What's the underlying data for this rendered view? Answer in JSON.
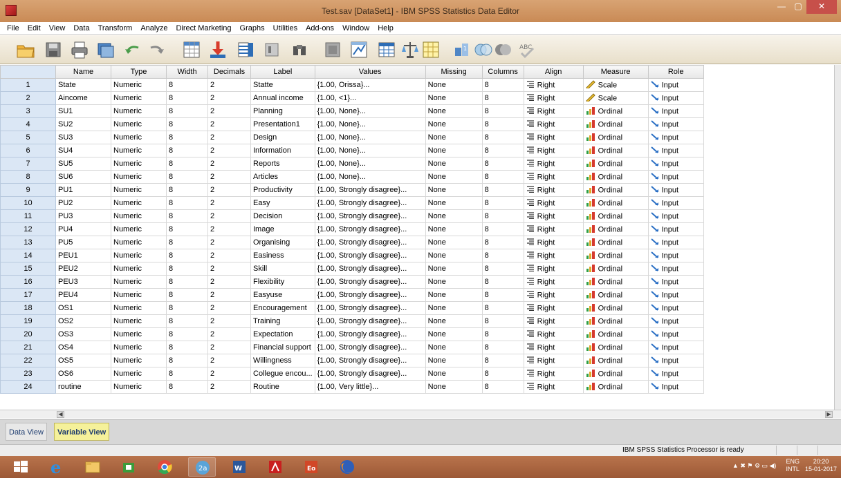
{
  "window": {
    "title": "Test.sav [DataSet1] - IBM SPSS Statistics Data Editor"
  },
  "menu": [
    "File",
    "Edit",
    "View",
    "Data",
    "Transform",
    "Analyze",
    "Direct Marketing",
    "Graphs",
    "Utilities",
    "Add-ons",
    "Window",
    "Help"
  ],
  "toolbar_icons": [
    "open-file-icon",
    "save-icon",
    "print-icon",
    "dialog-recall-icon",
    "undo-icon",
    "redo-icon",
    "go-to-case-icon",
    "go-to-variable-icon",
    "variables-icon",
    "run-descriptives-icon",
    "find-icon",
    "insert-cases-icon",
    "insert-variable-icon",
    "split-file-icon",
    "weight-cases-icon",
    "select-cases-icon",
    "value-labels-icon",
    "use-sets-icon",
    "show-all-variables-icon",
    "spell-check-icon"
  ],
  "grid": {
    "columns": [
      "",
      "Name",
      "Type",
      "Width",
      "Decimals",
      "Label",
      "Values",
      "Missing",
      "Columns",
      "Align",
      "Measure",
      "Role"
    ],
    "rows": [
      {
        "n": "1",
        "name": "State",
        "type": "Numeric",
        "width": "8",
        "decimals": "2",
        "label": "Statte",
        "values": "{1.00, Orissa}...",
        "missing": "None",
        "columns": "8",
        "align": "Right",
        "measure": "Scale",
        "role": "Input"
      },
      {
        "n": "2",
        "name": "Aincome",
        "type": "Numeric",
        "width": "8",
        "decimals": "2",
        "label": "Annual income",
        "values": "{1.00, <1}...",
        "missing": "None",
        "columns": "8",
        "align": "Right",
        "measure": "Scale",
        "role": "Input"
      },
      {
        "n": "3",
        "name": "SU1",
        "type": "Numeric",
        "width": "8",
        "decimals": "2",
        "label": "Planning",
        "values": "{1.00, None}...",
        "missing": "None",
        "columns": "8",
        "align": "Right",
        "measure": "Ordinal",
        "role": "Input"
      },
      {
        "n": "4",
        "name": "SU2",
        "type": "Numeric",
        "width": "8",
        "decimals": "2",
        "label": "Presentation1",
        "values": "{1.00, None}...",
        "missing": "None",
        "columns": "8",
        "align": "Right",
        "measure": "Ordinal",
        "role": "Input"
      },
      {
        "n": "5",
        "name": "SU3",
        "type": "Numeric",
        "width": "8",
        "decimals": "2",
        "label": "Design",
        "values": "{1.00, None}...",
        "missing": "None",
        "columns": "8",
        "align": "Right",
        "measure": "Ordinal",
        "role": "Input"
      },
      {
        "n": "6",
        "name": "SU4",
        "type": "Numeric",
        "width": "8",
        "decimals": "2",
        "label": "Information",
        "values": "{1.00, None}...",
        "missing": "None",
        "columns": "8",
        "align": "Right",
        "measure": "Ordinal",
        "role": "Input"
      },
      {
        "n": "7",
        "name": "SU5",
        "type": "Numeric",
        "width": "8",
        "decimals": "2",
        "label": "Reports",
        "values": "{1.00, None}...",
        "missing": "None",
        "columns": "8",
        "align": "Right",
        "measure": "Ordinal",
        "role": "Input"
      },
      {
        "n": "8",
        "name": "SU6",
        "type": "Numeric",
        "width": "8",
        "decimals": "2",
        "label": "Articles",
        "values": "{1.00, None}...",
        "missing": "None",
        "columns": "8",
        "align": "Right",
        "measure": "Ordinal",
        "role": "Input"
      },
      {
        "n": "9",
        "name": "PU1",
        "type": "Numeric",
        "width": "8",
        "decimals": "2",
        "label": "Productivity",
        "values": "{1.00, Strongly disagree}...",
        "missing": "None",
        "columns": "8",
        "align": "Right",
        "measure": "Ordinal",
        "role": "Input"
      },
      {
        "n": "10",
        "name": "PU2",
        "type": "Numeric",
        "width": "8",
        "decimals": "2",
        "label": "Easy",
        "values": "{1.00, Strongly disagree}...",
        "missing": "None",
        "columns": "8",
        "align": "Right",
        "measure": "Ordinal",
        "role": "Input"
      },
      {
        "n": "11",
        "name": "PU3",
        "type": "Numeric",
        "width": "8",
        "decimals": "2",
        "label": "Decision",
        "values": "{1.00, Strongly disagree}...",
        "missing": "None",
        "columns": "8",
        "align": "Right",
        "measure": "Ordinal",
        "role": "Input"
      },
      {
        "n": "12",
        "name": "PU4",
        "type": "Numeric",
        "width": "8",
        "decimals": "2",
        "label": "Image",
        "values": "{1.00, Strongly disagree}...",
        "missing": "None",
        "columns": "8",
        "align": "Right",
        "measure": "Ordinal",
        "role": "Input"
      },
      {
        "n": "13",
        "name": "PU5",
        "type": "Numeric",
        "width": "8",
        "decimals": "2",
        "label": "Organising",
        "values": "{1.00, Strongly disagree}...",
        "missing": "None",
        "columns": "8",
        "align": "Right",
        "measure": "Ordinal",
        "role": "Input"
      },
      {
        "n": "14",
        "name": "PEU1",
        "type": "Numeric",
        "width": "8",
        "decimals": "2",
        "label": "Easiness",
        "values": "{1.00, Strongly disagree}...",
        "missing": "None",
        "columns": "8",
        "align": "Right",
        "measure": "Ordinal",
        "role": "Input"
      },
      {
        "n": "15",
        "name": "PEU2",
        "type": "Numeric",
        "width": "8",
        "decimals": "2",
        "label": "Skill",
        "values": "{1.00, Strongly disagree}...",
        "missing": "None",
        "columns": "8",
        "align": "Right",
        "measure": "Ordinal",
        "role": "Input"
      },
      {
        "n": "16",
        "name": "PEU3",
        "type": "Numeric",
        "width": "8",
        "decimals": "2",
        "label": "Flexibility",
        "values": "{1.00, Strongly disagree}...",
        "missing": "None",
        "columns": "8",
        "align": "Right",
        "measure": "Ordinal",
        "role": "Input"
      },
      {
        "n": "17",
        "name": "PEU4",
        "type": "Numeric",
        "width": "8",
        "decimals": "2",
        "label": "Easyuse",
        "values": "{1.00, Strongly disagree}...",
        "missing": "None",
        "columns": "8",
        "align": "Right",
        "measure": "Ordinal",
        "role": "Input"
      },
      {
        "n": "18",
        "name": "OS1",
        "type": "Numeric",
        "width": "8",
        "decimals": "2",
        "label": "Encouragement",
        "values": "{1.00, Strongly disagree}...",
        "missing": "None",
        "columns": "8",
        "align": "Right",
        "measure": "Ordinal",
        "role": "Input"
      },
      {
        "n": "19",
        "name": "OS2",
        "type": "Numeric",
        "width": "8",
        "decimals": "2",
        "label": "Training",
        "values": "{1.00, Strongly disagree}...",
        "missing": "None",
        "columns": "8",
        "align": "Right",
        "measure": "Ordinal",
        "role": "Input"
      },
      {
        "n": "20",
        "name": "OS3",
        "type": "Numeric",
        "width": "8",
        "decimals": "2",
        "label": "Expectation",
        "values": "{1.00, Strongly disagree}...",
        "missing": "None",
        "columns": "8",
        "align": "Right",
        "measure": "Ordinal",
        "role": "Input"
      },
      {
        "n": "21",
        "name": "OS4",
        "type": "Numeric",
        "width": "8",
        "decimals": "2",
        "label": "Financial support",
        "values": "{1.00, Strongly disagree}...",
        "missing": "None",
        "columns": "8",
        "align": "Right",
        "measure": "Ordinal",
        "role": "Input"
      },
      {
        "n": "22",
        "name": "OS5",
        "type": "Numeric",
        "width": "8",
        "decimals": "2",
        "label": "Willingness",
        "values": "{1.00, Strongly disagree}...",
        "missing": "None",
        "columns": "8",
        "align": "Right",
        "measure": "Ordinal",
        "role": "Input"
      },
      {
        "n": "23",
        "name": "OS6",
        "type": "Numeric",
        "width": "8",
        "decimals": "2",
        "label": "Collegue encou...",
        "values": "{1.00, Strongly disagree}...",
        "missing": "None",
        "columns": "8",
        "align": "Right",
        "measure": "Ordinal",
        "role": "Input"
      },
      {
        "n": "24",
        "name": "routine",
        "type": "Numeric",
        "width": "8",
        "decimals": "2",
        "label": "Routine",
        "values": "{1.00, Very little}...",
        "missing": "None",
        "columns": "8",
        "align": "Right",
        "measure": "Ordinal",
        "role": "Input"
      }
    ]
  },
  "tabs": {
    "data_view": "Data View",
    "variable_view": "Variable View"
  },
  "status": {
    "message": "IBM SPSS Statistics Processor is ready"
  },
  "taskbar": {
    "apps": [
      "start-icon",
      "internet-explorer-icon",
      "file-explorer-icon",
      "store-icon",
      "chrome-icon",
      "spss-icon",
      "word-icon",
      "acrobat-icon",
      "presentation-icon",
      "firefox-icon"
    ],
    "lang_top": "ENG",
    "lang_bottom": "INTL",
    "time": "20:20",
    "date": "15-01-2017"
  },
  "colors": {
    "row_header": "#dbe7f5",
    "active_tab": "#f5f19a",
    "title_bar": "#c98a55",
    "taskbar": "#9c5836"
  }
}
